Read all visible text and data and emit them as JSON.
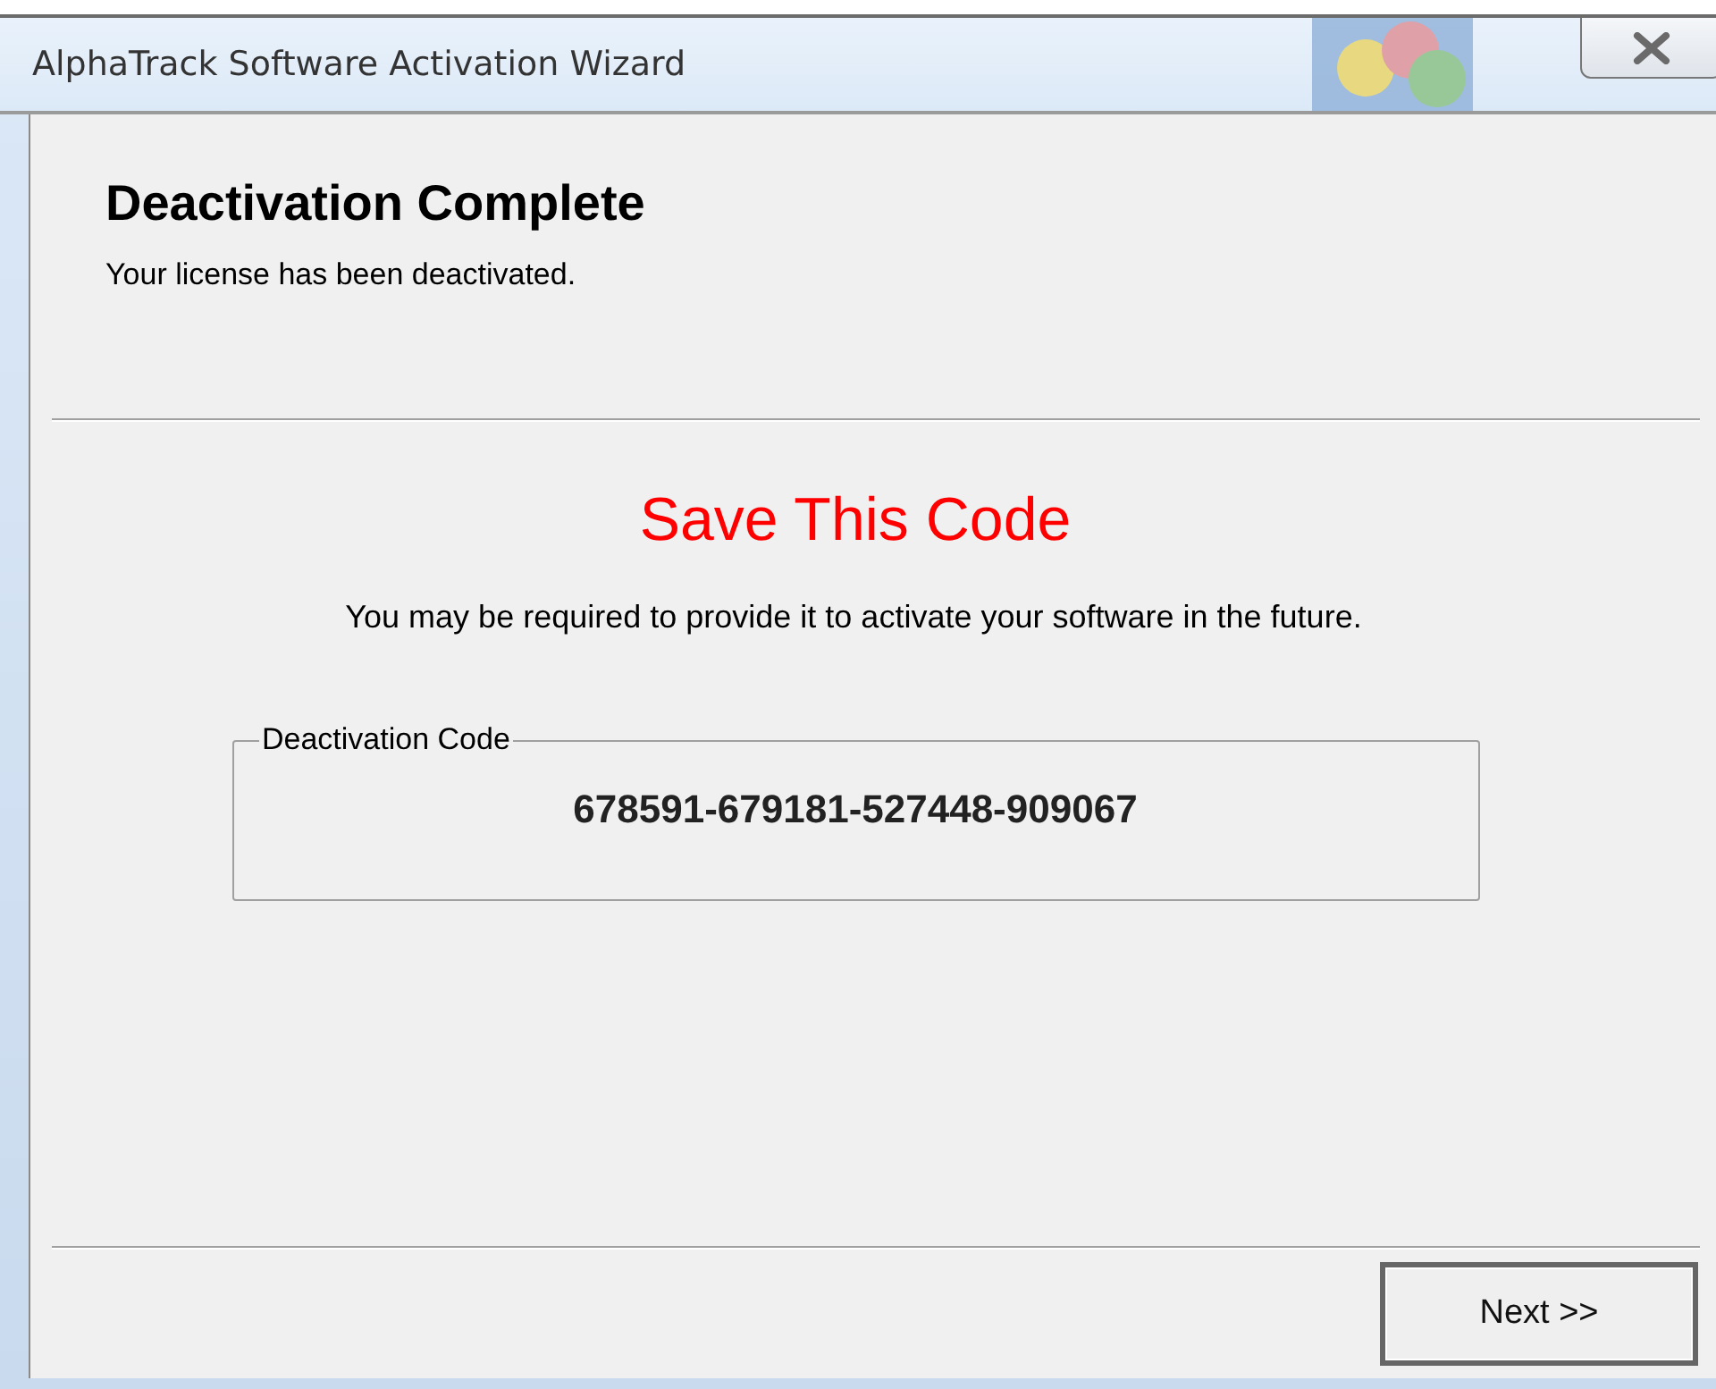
{
  "window": {
    "title": "AlphaTrack Software Activation Wizard"
  },
  "header": {
    "title": "Deactivation Complete",
    "subtitle": "Your license has been deactivated."
  },
  "notice": {
    "title": "Save This Code",
    "message": "You may be required to provide it to activate your software in the future."
  },
  "code_group": {
    "legend": "Deactivation Code",
    "value": "678591-679181-527448-909067"
  },
  "buttons": [
    {
      "label": "Next >>",
      "default": true
    }
  ]
}
